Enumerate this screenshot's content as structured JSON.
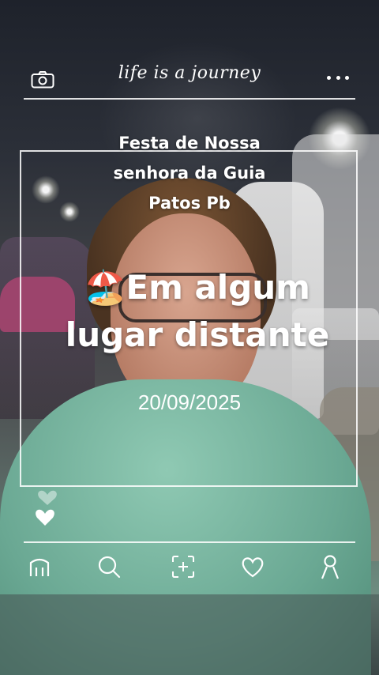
{
  "header": {
    "tagline": "life is a journey",
    "left_icon": "camera-icon",
    "right_icon": "more-icon"
  },
  "overlay": {
    "title_lines": [
      "Festa de Nossa",
      "senhora da Guia",
      "Patos Pb"
    ],
    "headline_emoji": "🏖️",
    "headline_lines": [
      "Em algum",
      "lugar distante"
    ],
    "date": "20/09/2025"
  },
  "reactions": {
    "icon": "heart-icon"
  },
  "nav": {
    "items": [
      {
        "icon": "home-icon"
      },
      {
        "icon": "search-icon"
      },
      {
        "icon": "add-icon"
      },
      {
        "icon": "heart-outline-icon"
      },
      {
        "icon": "profile-icon"
      }
    ]
  },
  "colors": {
    "overlay_text": "#ffffff"
  }
}
